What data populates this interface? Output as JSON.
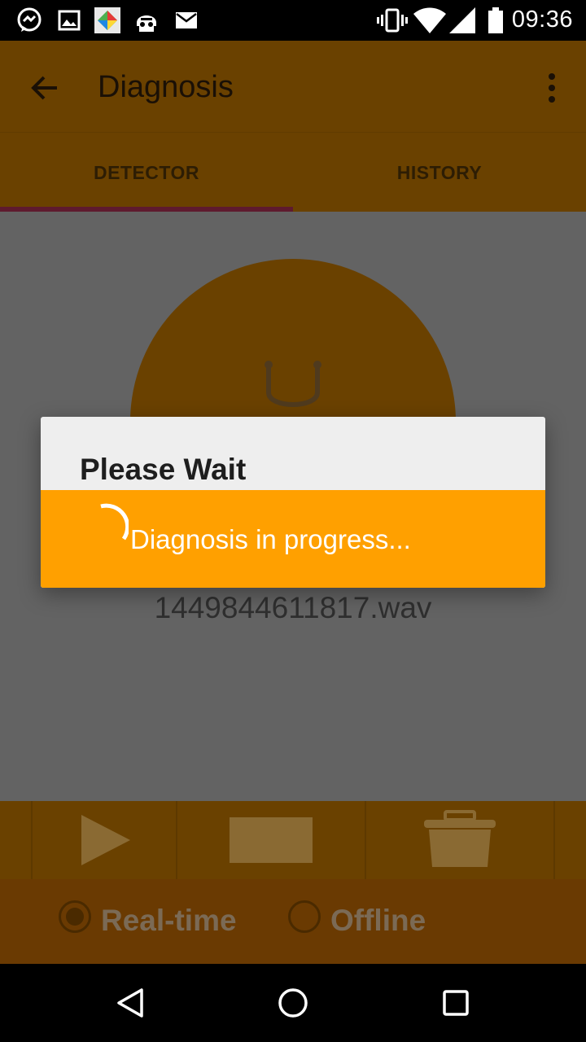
{
  "status_bar": {
    "time": "09:36",
    "icons": [
      "messenger-icon",
      "gallery-icon",
      "app-icon",
      "helmet-icon",
      "mail-icon",
      "vibrate-icon",
      "wifi-icon",
      "signal-icon",
      "battery-icon"
    ]
  },
  "app_bar": {
    "title": "Diagnosis",
    "icons": [
      "back-arrow-icon",
      "overflow-menu-icon"
    ]
  },
  "tabs": [
    {
      "label": "DETECTOR",
      "selected": true
    },
    {
      "label": "HISTORY",
      "selected": false
    }
  ],
  "main": {
    "filename": "1449844611817.wav",
    "icon": "stethoscope-icon"
  },
  "controls": {
    "buttons": [
      "play-icon",
      "stop-icon",
      "delete-icon"
    ]
  },
  "mode": {
    "options": [
      {
        "label": "Real-time",
        "selected": true
      },
      {
        "label": "Offline",
        "selected": false
      }
    ]
  },
  "dialog": {
    "title": "Please Wait",
    "message": "Diagnosis in progress..."
  },
  "nav_bar": {
    "icons": [
      "back-triangle-icon",
      "home-circle-icon",
      "recents-square-icon"
    ]
  },
  "colors": {
    "accent": "#ffa000",
    "app_bar_dimmed": "#6a4100",
    "tab_indicator": "#5e1a2e"
  }
}
